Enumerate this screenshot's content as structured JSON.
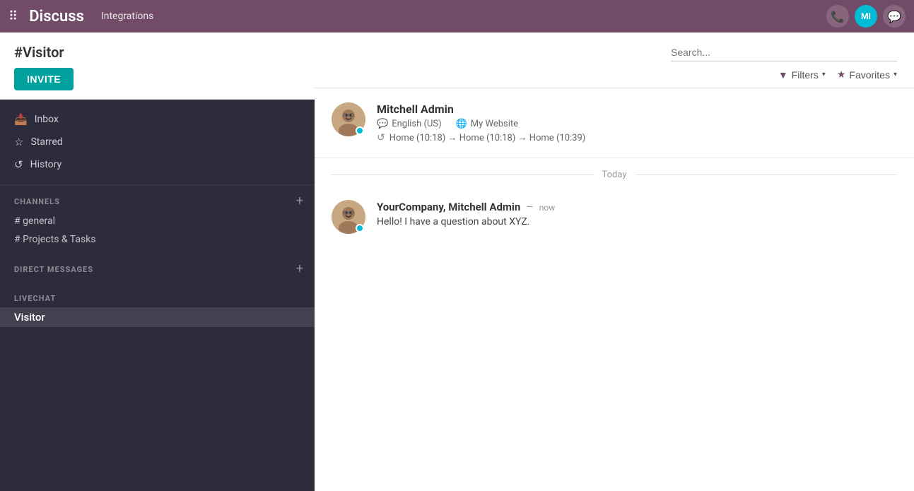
{
  "topnav": {
    "title": "Discuss",
    "integrations_label": "Integrations",
    "user_initials": "MI"
  },
  "sidebar": {
    "channel_title": "#Visitor",
    "invite_button": "INVITE",
    "nav_items": [
      {
        "icon": "📥",
        "label": "Inbox"
      },
      {
        "icon": "☆",
        "label": "Starred"
      },
      {
        "icon": "⟳",
        "label": "History"
      }
    ],
    "channels_section": {
      "title": "CHANNELS",
      "add_label": "+",
      "items": [
        {
          "label": "# general"
        },
        {
          "label": "# Projects & Tasks"
        }
      ]
    },
    "direct_messages_section": {
      "title": "DIRECT MESSAGES",
      "add_label": "+"
    },
    "livechat_section": {
      "title": "LIVECHAT",
      "items": [
        {
          "label": "Visitor",
          "active": true
        }
      ]
    }
  },
  "content": {
    "search_placeholder": "Search...",
    "filters_label": "Filters",
    "favorites_label": "Favorites"
  },
  "visitor_card": {
    "name": "Mitchell Admin",
    "language": "English (US)",
    "website": "My Website",
    "path": "Home (10:18) → Home (10:18) → Home (10:39)"
  },
  "today_divider": {
    "label": "Today"
  },
  "message": {
    "sender": "YourCompany, Mitchell Admin",
    "time": "now",
    "separator": "–",
    "text": "Hello! I have a question about XYZ."
  }
}
